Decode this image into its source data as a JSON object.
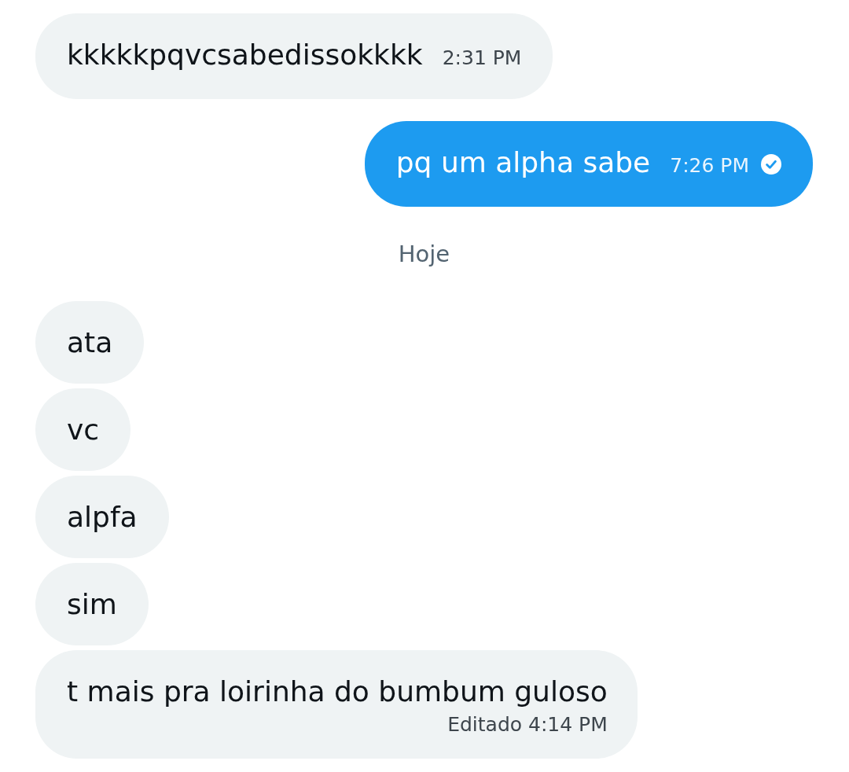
{
  "conversation": [
    {
      "kind": "received",
      "text": "kkkkkpqvcsabedissokkkk",
      "time": "2:31 PM",
      "edited": false
    },
    {
      "kind": "sent",
      "text": "pq um alpha sabe",
      "time": "7:26 PM",
      "edited": false,
      "read": true
    },
    {
      "kind": "day",
      "text": "Hoje"
    },
    {
      "kind": "received",
      "text": "ata",
      "edited": false
    },
    {
      "kind": "received",
      "text": "vc",
      "edited": false
    },
    {
      "kind": "received",
      "text": "alpfa",
      "edited": false
    },
    {
      "kind": "received",
      "text": "sim",
      "edited": false
    },
    {
      "kind": "received",
      "text": "t mais pra loirinha do bumbum guloso",
      "time": "Editado 4:14 PM",
      "edited": true
    }
  ]
}
